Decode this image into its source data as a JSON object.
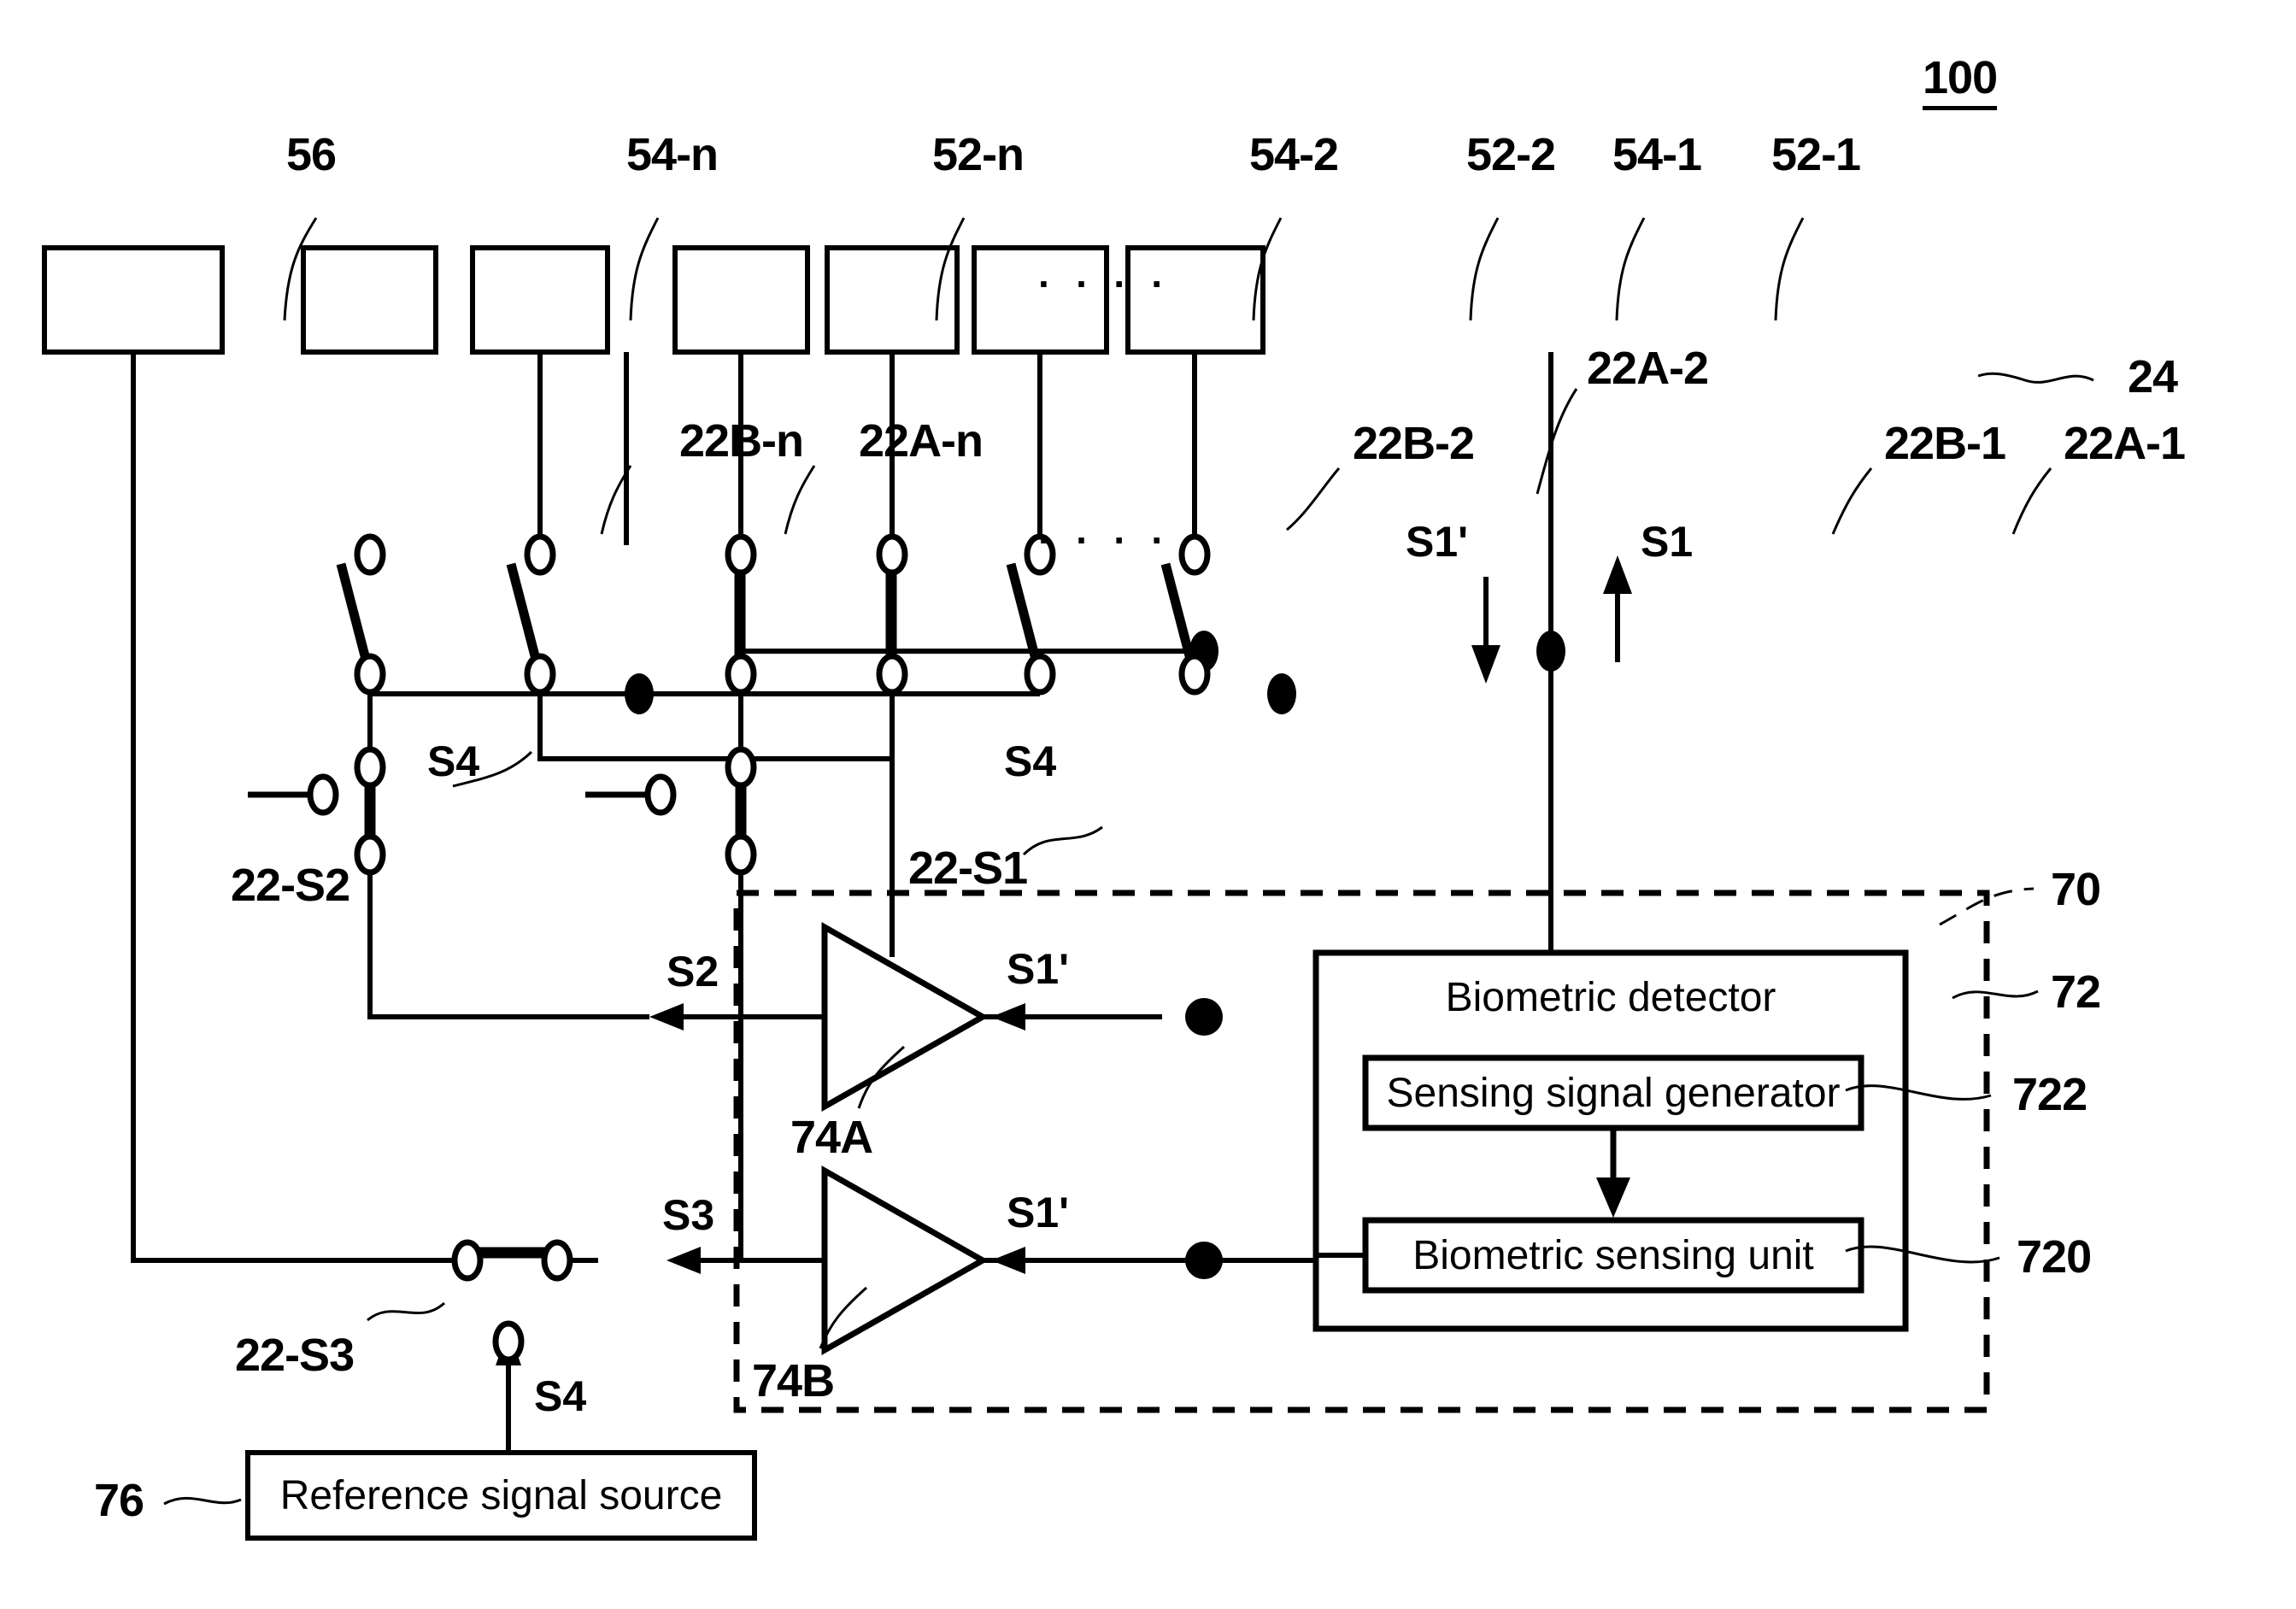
{
  "figure": {
    "id": "100",
    "title_ref": "100"
  },
  "top_boxes": [
    {
      "ref": "56",
      "name": "box-56"
    },
    {
      "ref": "54-n",
      "name": "box-54-n"
    },
    {
      "ref": "52-n",
      "name": "box-52-n"
    },
    {
      "ref": "54-2",
      "name": "box-54-2"
    },
    {
      "ref": "52-2",
      "name": "box-52-2"
    },
    {
      "ref": "54-1",
      "name": "box-54-1"
    },
    {
      "ref": "52-1",
      "name": "box-52-1"
    }
  ],
  "switch_refs": {
    "s22B_n": "22B-n",
    "s22A_n": "22A-n",
    "s22B_2": "22B-2",
    "s22A_2": "22A-2",
    "s22B_1": "22B-1",
    "s22A_1": "22A-1",
    "s22_S1": "22-S1",
    "s22_S2": "22-S2",
    "s22_S3": "22-S3",
    "bus_24": "24"
  },
  "signals": {
    "s1": "S1",
    "s1_prime_top": "S1'",
    "s1_prime_a": "S1'",
    "s1_prime_b": "S1'",
    "s2": "S2",
    "s3": "S3",
    "s4_left": "S4",
    "s4_mid": "S4",
    "s4_bottom": "S4"
  },
  "amplifiers": {
    "a74A": "74A",
    "a74B": "74B"
  },
  "detector": {
    "outer_ref": "70",
    "box_ref": "72",
    "title": "Biometric detector",
    "generator_ref": "722",
    "generator_label": "Sensing signal generator",
    "sensing_ref": "720",
    "sensing_label": "Biometric sensing unit"
  },
  "reference_source": {
    "ref": "76",
    "label": "Reference signal source"
  },
  "ellipsis": "· · · ·",
  "colors": {
    "stroke": "#000000",
    "background": "#ffffff"
  }
}
